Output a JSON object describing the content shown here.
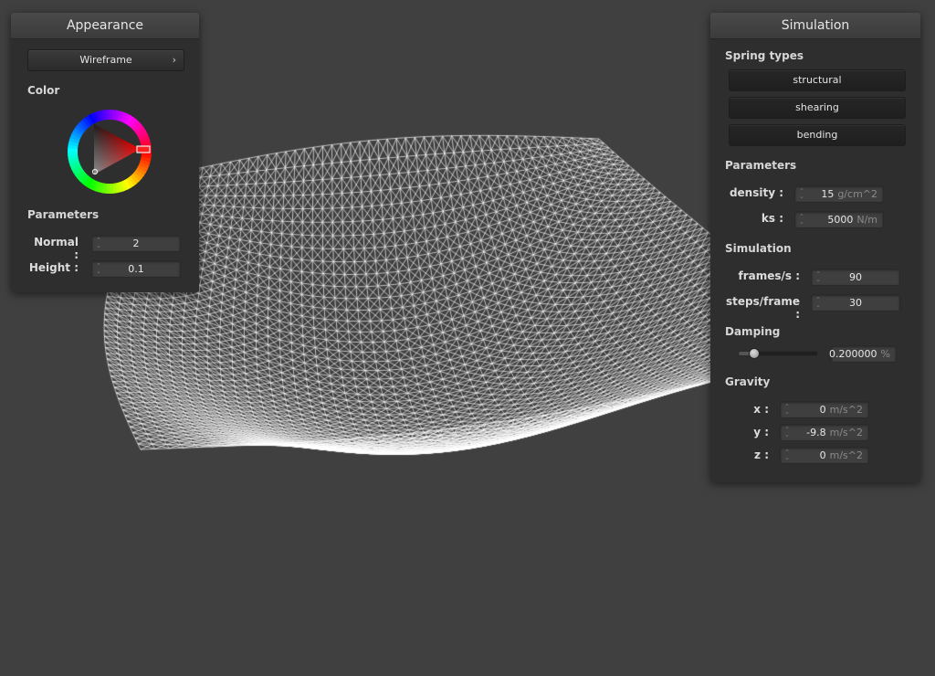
{
  "appearance": {
    "title": "Appearance",
    "mode_button": "Wireframe",
    "color_label": "Color",
    "color_wheel": {
      "hue_marker_color": "#ff2020"
    },
    "parameters_label": "Parameters",
    "normal": {
      "label": "Normal :",
      "value": "2"
    },
    "height": {
      "label": "Height :",
      "value": "0.1"
    }
  },
  "simulation": {
    "title": "Simulation",
    "spring_types_label": "Spring types",
    "spring_types": [
      "structural",
      "shearing",
      "bending"
    ],
    "parameters_label": "Parameters",
    "density": {
      "label": "density :",
      "value": "15",
      "unit": "g/cm^2"
    },
    "ks": {
      "label": "ks :",
      "value": "5000",
      "unit": "N/m"
    },
    "simulation_label": "Simulation",
    "frames": {
      "label": "frames/s :",
      "value": "90"
    },
    "steps": {
      "label": "steps/frame :",
      "value": "30"
    },
    "damping_label": "Damping",
    "damping": {
      "value": "0.200000",
      "unit": "%",
      "slider_fraction": 0.2
    },
    "gravity_label": "Gravity",
    "gravity": {
      "x": {
        "label": "x :",
        "value": "0",
        "unit": "m/s^2"
      },
      "y": {
        "label": "y :",
        "value": "-9.8",
        "unit": "m/s^2"
      },
      "z": {
        "label": "z :",
        "value": "0",
        "unit": "m/s^2"
      }
    }
  },
  "colors": {
    "background": "#404040",
    "panel": "#2e2e2e",
    "wireframe": "#ffffff"
  }
}
